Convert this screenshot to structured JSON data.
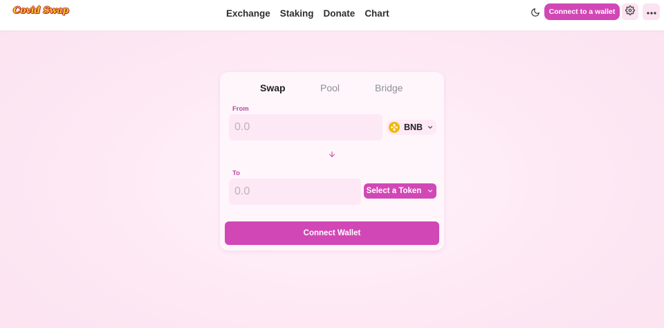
{
  "header": {
    "logo_text": "Covid Swap",
    "nav": [
      "Exchange",
      "Staking",
      "Donate",
      "Chart"
    ],
    "connect_label": "Connect to a wallet",
    "icons": [
      "moon-icon",
      "gear-icon",
      "more-icon"
    ]
  },
  "swap_card": {
    "tabs": [
      "Swap",
      "Pool",
      "Bridge"
    ],
    "active_tab": "Swap",
    "from": {
      "label": "From",
      "placeholder": "0.0",
      "token": "BNB"
    },
    "to": {
      "label": "To",
      "placeholder": "0.0",
      "select_label": "Select a Token"
    },
    "connect_wallet_label": "Connect Wallet"
  },
  "colors": {
    "accent": "#d247b6",
    "background": "#fde8f4",
    "input_bg": "#fde8f5",
    "label": "#b9479c",
    "bnb": "#f0b90b"
  }
}
